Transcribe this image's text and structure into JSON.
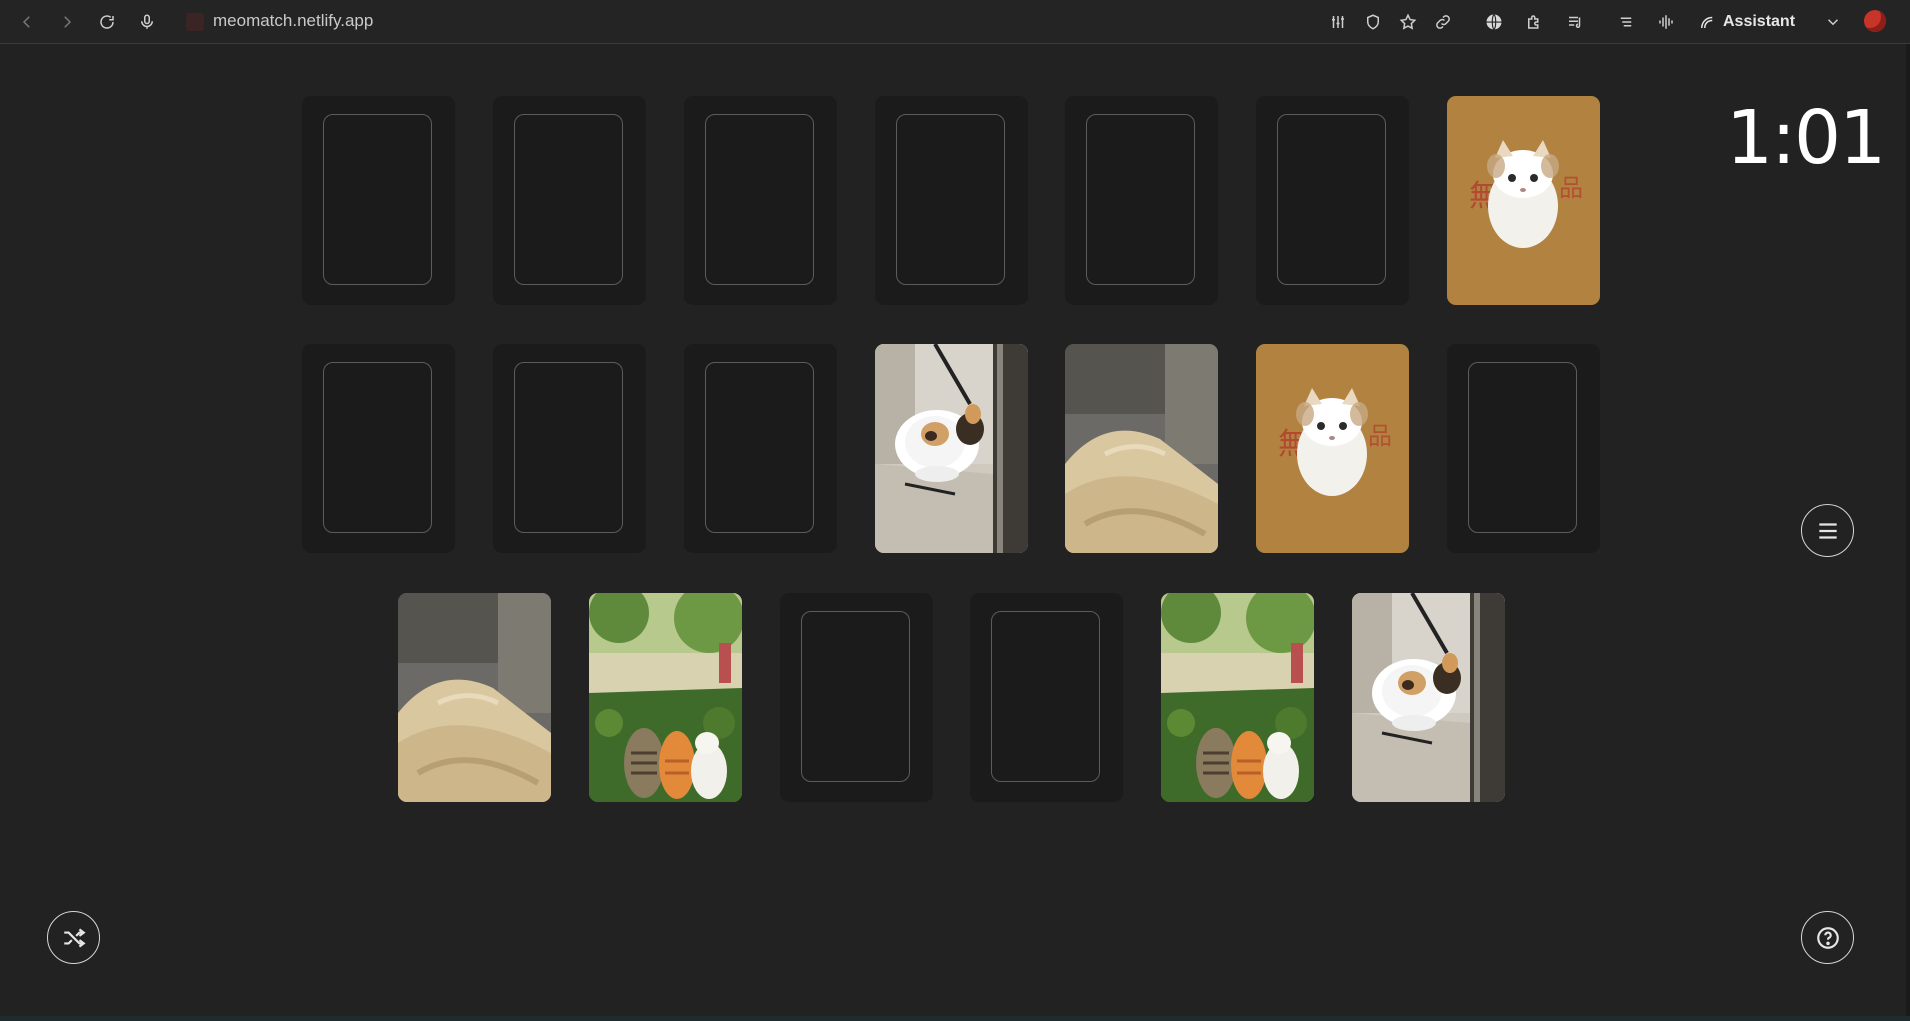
{
  "browser": {
    "url": "meomatch.netlify.app",
    "assistant_label": "Assistant",
    "icons": [
      "back-icon",
      "forward-icon",
      "reload-icon",
      "microphone-icon",
      "sliders-icon",
      "shield-icon",
      "star-icon",
      "link-icon",
      "globe-icon",
      "puzzle-icon",
      "playlist-icon",
      "menu-lines-icon",
      "soundwave-icon",
      "chevron-down-icon"
    ]
  },
  "game": {
    "timer": "1:01",
    "cards": [
      [
        "down",
        "down",
        "down",
        "down",
        "down",
        "down",
        "cat-box"
      ],
      [
        "down",
        "down",
        "down",
        "cat-calico",
        "bed",
        "cat-box",
        "down"
      ],
      [
        "bed",
        "cats-garden",
        "down",
        "down",
        "cats-garden",
        "cat-calico"
      ]
    ]
  },
  "colors": {
    "background": "#222222",
    "card_back": "#1b1b1b",
    "card_border": "#5c5c5c",
    "text": "#ffffff"
  },
  "controls": [
    "menu-button",
    "shuffle-button",
    "help-button"
  ]
}
